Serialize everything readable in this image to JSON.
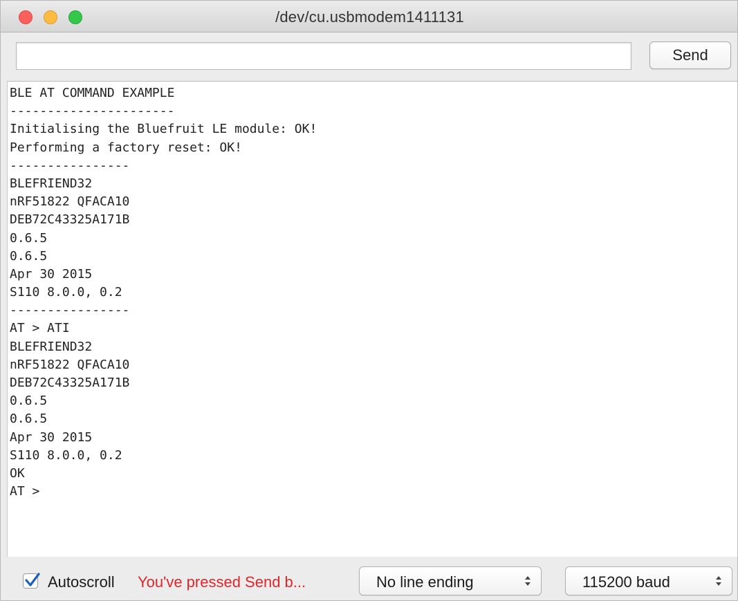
{
  "window": {
    "title": "/dev/cu.usbmodem1411131"
  },
  "toolbar": {
    "input_value": "",
    "send_label": "Send"
  },
  "output": {
    "lines": [
      "BLE AT COMMAND EXAMPLE",
      "----------------------",
      "Initialising the Bluefruit LE module: OK!",
      "Performing a factory reset: OK!",
      "----------------",
      "BLEFRIEND32",
      "nRF51822 QFACA10",
      "DEB72C43325A171B",
      "0.6.5",
      "0.6.5",
      "Apr 30 2015",
      "S110 8.0.0, 0.2",
      "----------------",
      "AT > ATI",
      "BLEFRIEND32",
      "nRF51822 QFACA10",
      "DEB72C43325A171B",
      "0.6.5",
      "0.6.5",
      "Apr 30 2015",
      "S110 8.0.0, 0.2",
      "OK",
      "AT >"
    ]
  },
  "status": {
    "autoscroll_checked": true,
    "autoscroll_label": "Autoscroll",
    "warning": "You've pressed Send b...",
    "line_ending": "No line ending",
    "baud": "115200 baud"
  },
  "icons": {
    "close": "close-icon",
    "minimize": "minimize-icon",
    "maximize": "maximize-icon",
    "checkmark": "checkmark-icon",
    "select_arrows": "up-down-arrows-icon"
  },
  "colors": {
    "close": "#fc605c",
    "minimize": "#fdbc40",
    "maximize": "#34c84a",
    "warning": "#e0262a",
    "checkmark": "#1e5fbd"
  }
}
